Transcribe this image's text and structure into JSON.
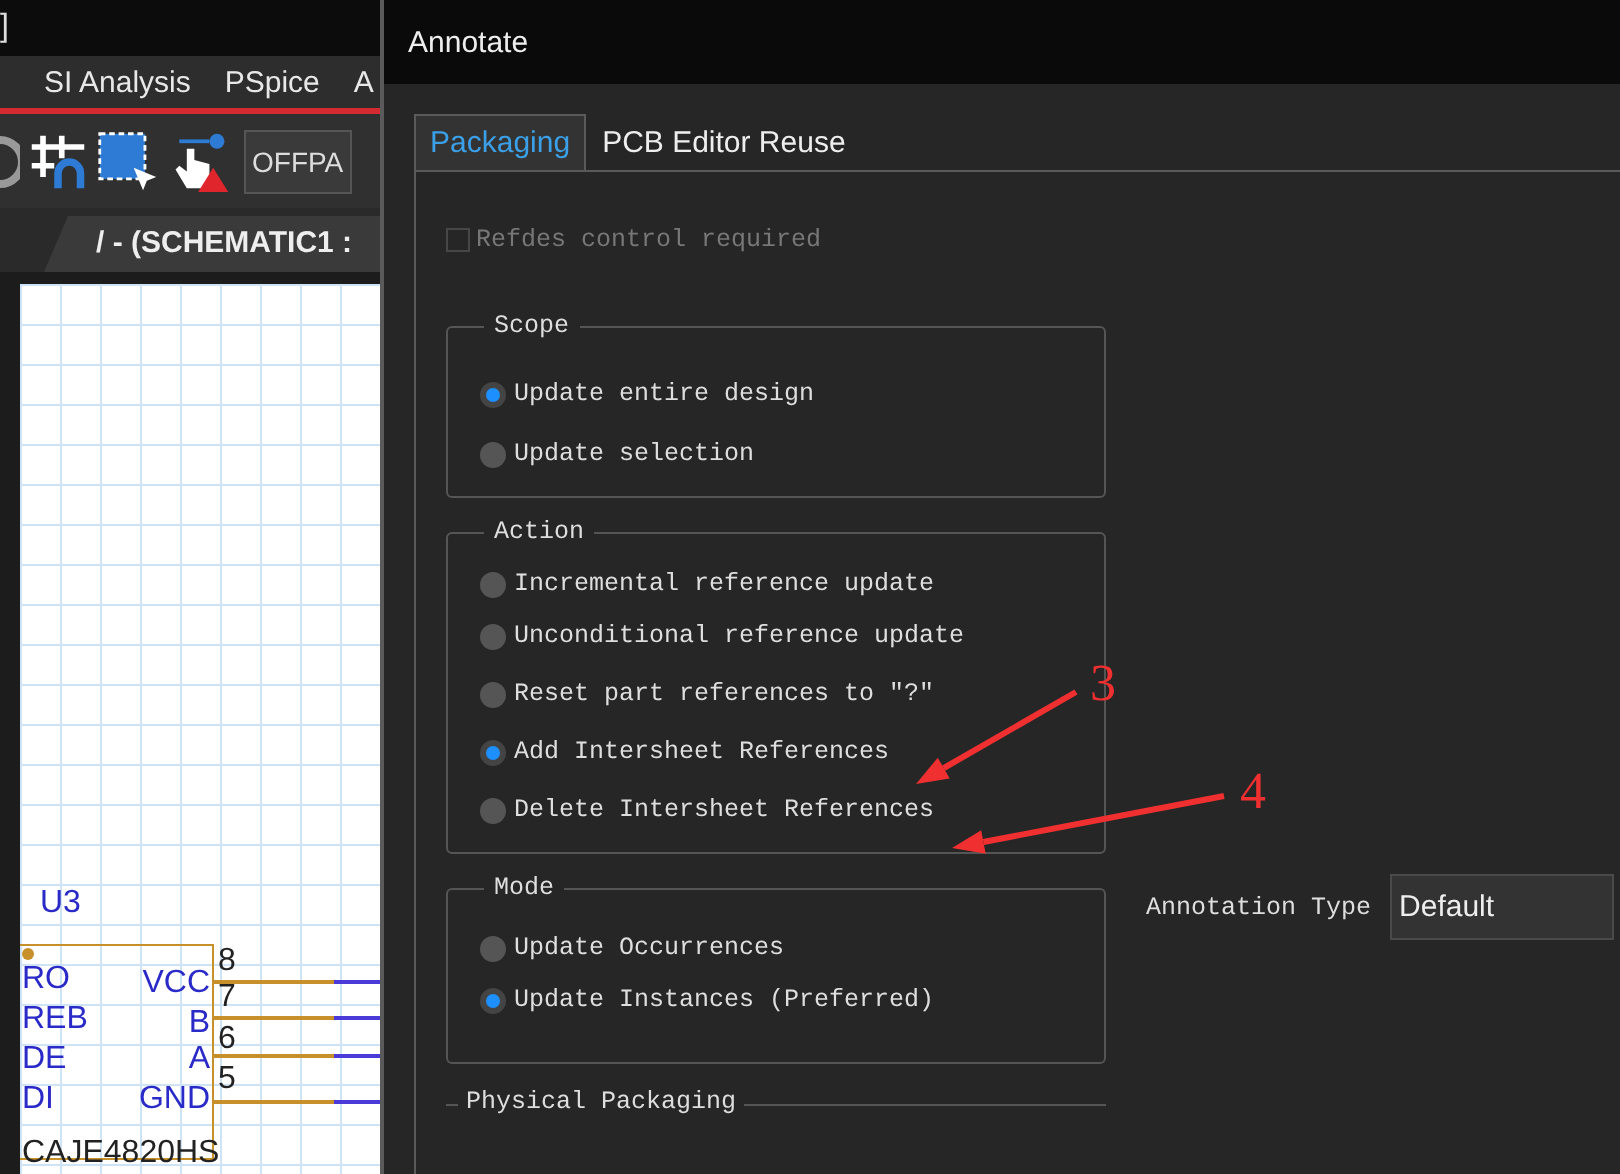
{
  "app": {
    "title_fragment": "]",
    "menu": [
      "SI Analysis",
      "PSpice",
      "A"
    ],
    "toolbar_field": "OFFPA",
    "document_tab": "/ - (SCHEMATIC1 :",
    "schematic": {
      "reference": "U3",
      "left_pins": [
        "RO",
        "REB",
        "DE",
        "DI"
      ],
      "right_pins": [
        "VCC",
        "B",
        "A",
        "GND"
      ],
      "pin_numbers": [
        "8",
        "7",
        "6",
        "5"
      ],
      "part": "CAJE4820HS"
    }
  },
  "dialog": {
    "title": "Annotate",
    "tabs": [
      {
        "label": "Packaging",
        "selected": true
      },
      {
        "label": "PCB Editor Reuse",
        "selected": false
      }
    ],
    "refdes": {
      "label": "Refdes control required",
      "checked": false,
      "disabled": true
    },
    "groups": [
      {
        "title": "Scope",
        "options": [
          {
            "label": "Update entire design",
            "selected": true
          },
          {
            "label": "Update selection",
            "selected": false
          }
        ]
      },
      {
        "title": "Action",
        "options": [
          {
            "label": "Incremental reference update",
            "selected": false
          },
          {
            "label": "Unconditional reference update",
            "selected": false
          },
          {
            "label": "Reset part references to \"?\"",
            "selected": false
          },
          {
            "label": "Add Intersheet References",
            "selected": true
          },
          {
            "label": "Delete Intersheet References",
            "selected": false
          }
        ]
      },
      {
        "title": "Mode",
        "options": [
          {
            "label": "Update Occurrences",
            "selected": false
          },
          {
            "label": "Update Instances (Preferred)",
            "selected": true
          }
        ]
      }
    ],
    "annotation_type": {
      "label": "Annotation Type",
      "value": "Default"
    },
    "next_group": "Physical Packaging"
  },
  "callouts": [
    {
      "label": "3"
    },
    {
      "label": "4"
    }
  ]
}
